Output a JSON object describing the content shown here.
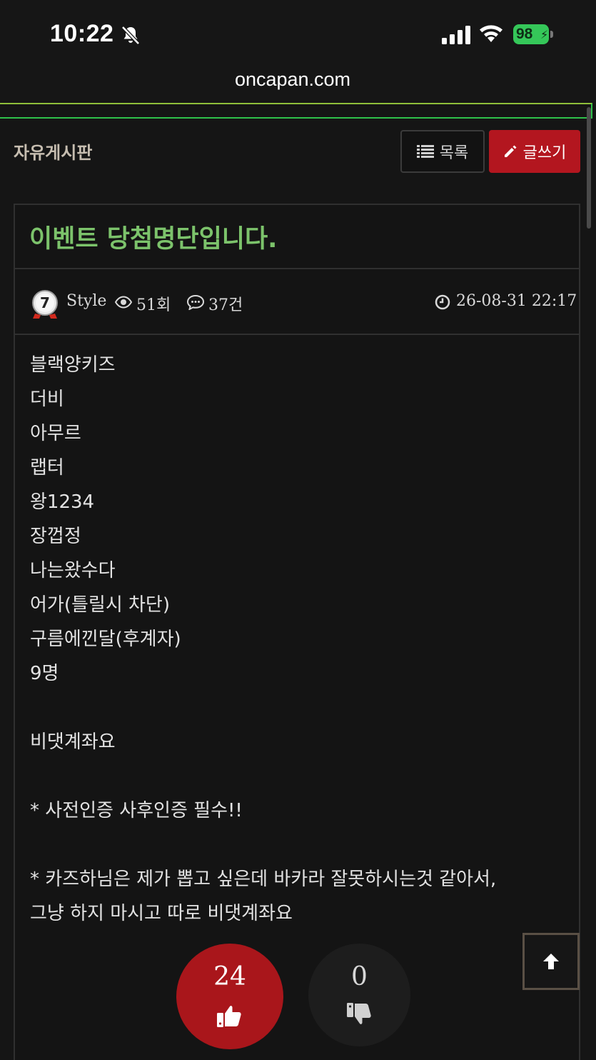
{
  "status_bar": {
    "time": "10:22",
    "battery": "98"
  },
  "browser": {
    "url": "oncapan.com"
  },
  "board": {
    "title": "자유게시판",
    "list_button": "목록",
    "write_button": "글쓰기"
  },
  "post": {
    "title": "이벤트 당첨명단입니다.",
    "author_level": "7",
    "author": "Style",
    "views": "51회",
    "comments": "37건",
    "date": "26-08-31 22:17",
    "lines": [
      "블랙양키즈",
      "더비",
      "아무르",
      "랩터",
      "왕1234",
      "장껍정",
      "나는왔수다",
      "어가(틀릴시 차단)",
      "구름에낀달(후계자)",
      "9명",
      "",
      "비댓계좌요",
      "",
      "* 사전인증 사후인증 필수!!",
      "",
      "* 카즈하님은 제가 뽑고 싶은데 바카라 잘못하시는것 같아서,",
      "그냥 하지 마시고 따로 비댓계좌요"
    ]
  },
  "votes": {
    "up": "24",
    "down": "0"
  },
  "icons": {
    "list": "list-icon",
    "write": "pencil-icon",
    "views": "eye-icon",
    "comments": "comment-icon",
    "date": "clock-icon",
    "up": "thumbs-up-icon",
    "down": "thumbs-down-icon",
    "to_top": "arrow-up-icon"
  },
  "colors": {
    "accent_red": "#b3161f",
    "title_green": "#7cc36b",
    "battery_green": "#35c759"
  }
}
